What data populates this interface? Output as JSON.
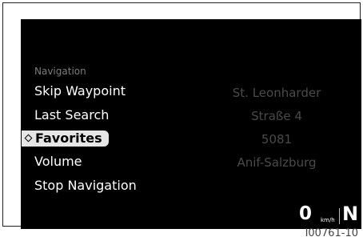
{
  "menu": {
    "header": "Navigation",
    "items": [
      {
        "label": "Skip Waypoint"
      },
      {
        "label": "Last Search"
      },
      {
        "label": "Favorites",
        "selected": true
      },
      {
        "label": "Volume"
      },
      {
        "label": "Stop Navigation"
      }
    ]
  },
  "address": {
    "lines": [
      "St. Leonharder",
      "Straße 4",
      "5081",
      "Anif-Salzburg"
    ]
  },
  "status": {
    "speed": "0",
    "speed_unit": "km/h",
    "gear": "N"
  },
  "figure_code": "I00761-10",
  "icons": {
    "selection_marker": "diamond-icon"
  },
  "colors": {
    "screen_background": "#000000",
    "selected_item_background": "#e6e6e6",
    "header_text": "#7c7c7c",
    "address_text": "#4a4a4a"
  }
}
